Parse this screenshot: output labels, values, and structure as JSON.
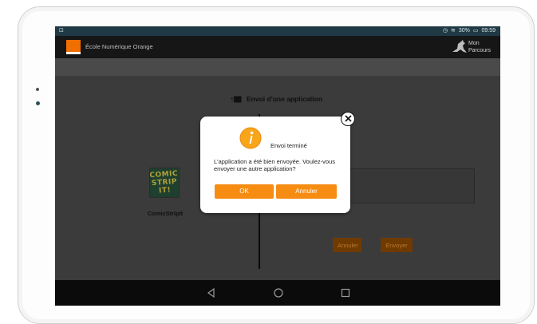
{
  "status_bar": {
    "left_indicator": "⊡",
    "battery_text": "30%",
    "time": "09:59"
  },
  "header": {
    "title": "École Numérique Orange",
    "parcours_label": "Mon Parcours"
  },
  "page": {
    "heading": "Envoi d'une application"
  },
  "app": {
    "name": "ComicStripIt",
    "tile_text": "COMIC STRIP IT!"
  },
  "actions": {
    "cancel_label": "Annuler",
    "send_label": "Envoyer"
  },
  "dialog": {
    "title": "Envoi terminé",
    "message": "L'application a été bien envoyée. Voulez-vous envoyer une autre application?",
    "ok_label": "OK",
    "cancel_label": "Annuler"
  },
  "colors": {
    "orange": "#f68c12",
    "brand_orange": "#f16e00",
    "status_bar": "#1f3a44",
    "overlay": "#3b3b3b"
  },
  "icons": {
    "close": "close-icon",
    "info": "info-icon",
    "send": "send-icon",
    "back": "back-icon",
    "home": "home-icon",
    "recents": "recents-icon"
  }
}
